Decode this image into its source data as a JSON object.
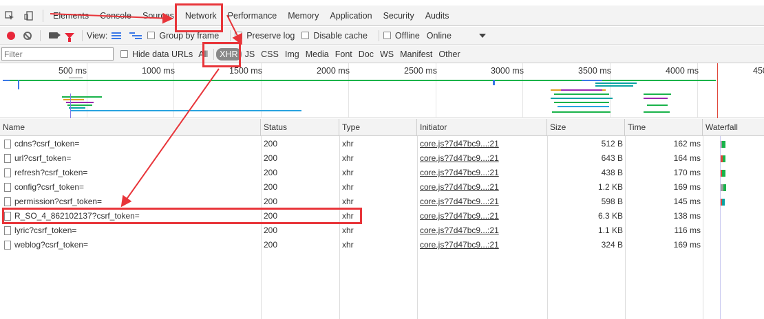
{
  "tabs": [
    {
      "label": "Elements"
    },
    {
      "label": "Console"
    },
    {
      "label": "Sources"
    },
    {
      "label": "Network"
    },
    {
      "label": "Performance"
    },
    {
      "label": "Memory"
    },
    {
      "label": "Application"
    },
    {
      "label": "Security"
    },
    {
      "label": "Audits"
    }
  ],
  "toolbar": {
    "view_label": "View:",
    "group_by_frame": "Group by frame",
    "preserve_log": "Preserve log",
    "disable_cache": "Disable cache",
    "offline": "Offline",
    "throttle": "Online"
  },
  "filter": {
    "placeholder": "Filter",
    "hide_data_urls": "Hide data URLs",
    "all": "All",
    "types": [
      "XHR",
      "JS",
      "CSS",
      "Img",
      "Media",
      "Font",
      "Doc",
      "WS",
      "Manifest",
      "Other"
    ],
    "selected": "XHR"
  },
  "overview": {
    "ticks": [
      "500 ms",
      "1000 ms",
      "1500 ms",
      "2000 ms",
      "2500 ms",
      "3000 ms",
      "3500 ms",
      "4000 ms",
      "450"
    ]
  },
  "table": {
    "headers": {
      "name": "Name",
      "status": "Status",
      "type": "Type",
      "initiator": "Initiator",
      "size": "Size",
      "time": "Time",
      "waterfall": "Waterfall"
    },
    "rows": [
      {
        "name": "cdns?csrf_token=",
        "status": "200",
        "type": "xhr",
        "initiator": "core.js?7d47bc9...:21",
        "size": "512 B",
        "time": "162 ms"
      },
      {
        "name": "url?csrf_token=",
        "status": "200",
        "type": "xhr",
        "initiator": "core.js?7d47bc9...:21",
        "size": "643 B",
        "time": "164 ms"
      },
      {
        "name": "refresh?csrf_token=",
        "status": "200",
        "type": "xhr",
        "initiator": "core.js?7d47bc9...:21",
        "size": "438 B",
        "time": "170 ms"
      },
      {
        "name": "config?csrf_token=",
        "status": "200",
        "type": "xhr",
        "initiator": "core.js?7d47bc9...:21",
        "size": "1.2 KB",
        "time": "169 ms"
      },
      {
        "name": "permission?csrf_token=",
        "status": "200",
        "type": "xhr",
        "initiator": "core.js?7d47bc9...:21",
        "size": "598 B",
        "time": "145 ms"
      },
      {
        "name": "R_SO_4_862102137?csrf_token=",
        "status": "200",
        "type": "xhr",
        "initiator": "core.js?7d47bc9...:21",
        "size": "6.3 KB",
        "time": "138 ms"
      },
      {
        "name": "lyric?csrf_token=",
        "status": "200",
        "type": "xhr",
        "initiator": "core.js?7d47bc9...:21",
        "size": "1.1 KB",
        "time": "116 ms"
      },
      {
        "name": "weblog?csrf_token=",
        "status": "200",
        "type": "xhr",
        "initiator": "core.js?7d47bc9...:21",
        "size": "324 B",
        "time": "169 ms"
      }
    ]
  },
  "colors": {
    "annotation": "#e8353a",
    "waterfall_green": "#19b34a",
    "waterfall_teal": "#0aa3a3",
    "waterfall_gray": "#9e9e9e",
    "waterfall_red": "#e0473a"
  }
}
